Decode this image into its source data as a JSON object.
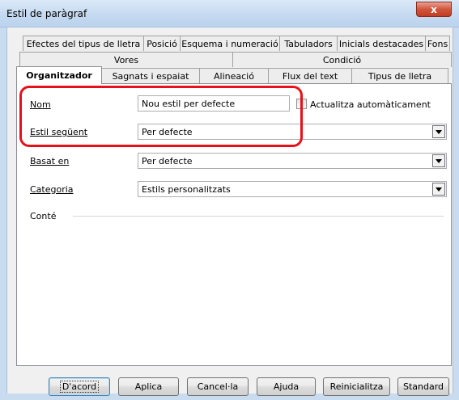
{
  "window": {
    "title": "Estil de paràgraf",
    "close_label": "x"
  },
  "tabs_row1": [
    "Efectes del tipus de lletra",
    "Posició",
    "Esquema i numeració",
    "Tabuladors",
    "Inicials destacades",
    "Fons"
  ],
  "tabs_row2": [
    "Vores",
    "Condició"
  ],
  "tabs_row3": [
    "Organitzador",
    "Sagnats i espaiat",
    "Alineació",
    "Flux del text",
    "Tipus de lletra"
  ],
  "active_tab": "Organitzador",
  "form": {
    "name_label": "Nom",
    "name_value": "Nou estil per defecte",
    "autoupdate_label": "Actualitza automàticament",
    "next_style_label": "Estil següent",
    "next_style_value": "Per defecte",
    "based_on_label": "Basat en",
    "based_on_value": "Per defecte",
    "category_label": "Categoria",
    "category_value": "Estils personalitzats",
    "contains_label": "Conté"
  },
  "buttons": {
    "ok": "D'acord",
    "apply": "Aplica",
    "cancel": "Cancel·la",
    "help": "Ajuda",
    "reset": "Reinicialitza",
    "standard": "Standard"
  },
  "colors": {
    "highlight": "#e8111a",
    "accent": "#3c7fb1"
  }
}
